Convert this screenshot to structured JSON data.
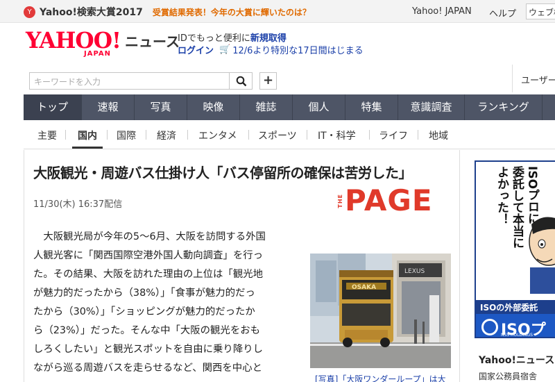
{
  "promo": {
    "title": "Yahoo!検索大賞2017",
    "text": "受賞結果発表！今年の大賞に輝いたのは？"
  },
  "top_links": {
    "yahoo_japan": "Yahoo! JAPAN",
    "help": "ヘルプ",
    "search_value": "ウェブ検"
  },
  "logo": {
    "main": "YAHOO!",
    "sub": "JAPAN",
    "service": "ニュース"
  },
  "id_promo": {
    "text": "IDでもっと便利に",
    "link": "新規取得",
    "login": "ログイン",
    "sale": "12/6より特別な17日間はじまる"
  },
  "search": {
    "placeholder": "キーワードを入力",
    "user_label": "ユーザー"
  },
  "main_nav": [
    "トップ",
    "速報",
    "写真",
    "映像",
    "雑誌",
    "個人",
    "特集",
    "意識調査",
    "ランキング"
  ],
  "sub_nav": [
    "主要",
    "国内",
    "国際",
    "経済",
    "エンタメ",
    "スポーツ",
    "IT・科学",
    "ライフ",
    "地域"
  ],
  "article": {
    "headline": "大阪観光・周遊バス仕掛け人「バス停留所の確保は苦労した」",
    "date": "11/30(木) 16:37配信",
    "source_the": "THE",
    "source_page": "PAGE",
    "lines": [
      "　大阪観光局が今年の5～6月、大阪を訪問する外国",
      "人観光客に「関西国際空港外国人動向調査」を行っ",
      "た。その結果、大阪を訪れた理由の上位は「観光地",
      "が魅力的だったから（38%）」「食事が魅力的だっ",
      "たから（30%）」「ショッピングが魅力的だったか",
      "ら（23%）」だった。そんな中「大阪の観光をおも",
      "しろくしたい」と観光スポットを自由に乗り降りし",
      "ながら巡る周遊バスを走らせるなど、関西を中心と"
    ],
    "photo_bus_sign": "OSAKA",
    "photo_store_sign": "LEXUS",
    "caption": "[写真]「大阪ワンダーループ」は大"
  },
  "ad": {
    "text_lines": [
      "ISOプロに",
      "委託して本当に",
      "よかった！"
    ],
    "band": "ISOの外部委託",
    "brand": "ISOプ",
    "brand_sub": "NSS HOLDINGS"
  },
  "sidebar": {
    "title": "Yahoo!ニュース",
    "sub": "国家公務員宿舎"
  },
  "colors": {
    "brand_red": "#ff0033",
    "nav_bg": "#4e5566",
    "link_blue": "#1a3fa8",
    "promo_orange": "#e06a00",
    "page_red": "#e03a2a"
  }
}
